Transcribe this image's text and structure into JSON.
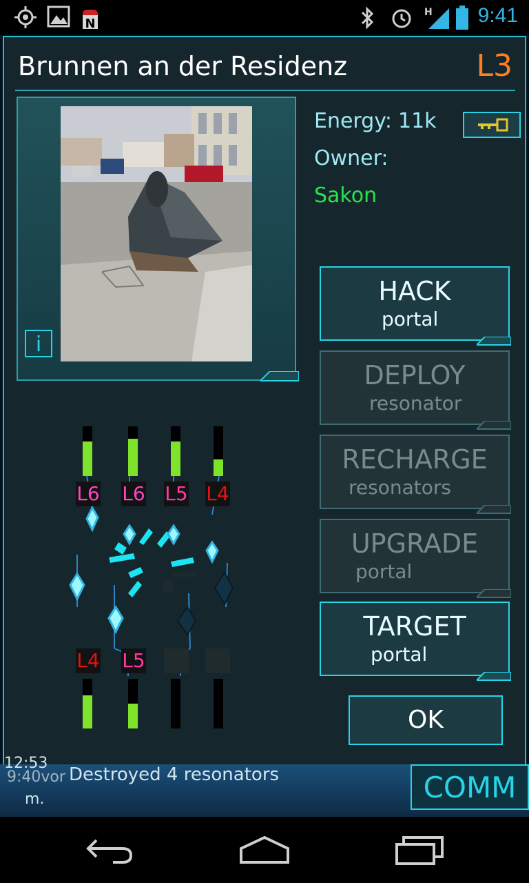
{
  "status_bar": {
    "time": "9:41",
    "icons": [
      "gps-icon",
      "image-icon",
      "android-n-icon",
      "bluetooth-icon",
      "alarm-icon",
      "signal-h-icon",
      "battery-icon"
    ]
  },
  "portal": {
    "name": "Brunnen an der Residenz",
    "level": "L3",
    "energy_label": "Energy:",
    "energy_value": "11k",
    "owner_label": "Owner:",
    "owner_name": "Sakon",
    "info_label": "i"
  },
  "resonators": {
    "top": [
      {
        "label": "L6",
        "color": "#ff44c4",
        "fill": 0.7
      },
      {
        "label": "L6",
        "color": "#ff44c4",
        "fill": 0.8
      },
      {
        "label": "L5",
        "color": "#ff3aa8",
        "fill": 0.7
      },
      {
        "label": "L4",
        "color": "#e01414",
        "fill": 0.33
      }
    ],
    "bottom": [
      {
        "label": "L4",
        "color": "#e01414",
        "fill": 0.67
      },
      {
        "label": "L5",
        "color": "#ff3aa8",
        "fill": 0.5
      },
      {
        "label": "",
        "color": "#2a2a2a",
        "fill": 0
      },
      {
        "label": "",
        "color": "#2a2a2a",
        "fill": 0
      }
    ]
  },
  "actions": [
    {
      "main": "HACK",
      "sub": "portal",
      "enabled": true
    },
    {
      "main": "DEPLOY",
      "sub": "resonator",
      "enabled": false
    },
    {
      "main": "RECHARGE",
      "sub": "resonators",
      "enabled": false
    },
    {
      "main": "UPGRADE",
      "sub": "portal",
      "enabled": false
    },
    {
      "main": "TARGET",
      "sub": "portal",
      "enabled": true
    }
  ],
  "ok_label": "OK",
  "comm": {
    "time_top": "12:53",
    "time_line": "9:40vor",
    "message": "Destroyed 4 resonators",
    "time_suffix": "m.",
    "tab_label": "COMM"
  },
  "colors": {
    "accent": "#27d4e6",
    "level": "#ff7f1f",
    "owner": "#28e34b",
    "energy_bar": "#7ee32a"
  }
}
